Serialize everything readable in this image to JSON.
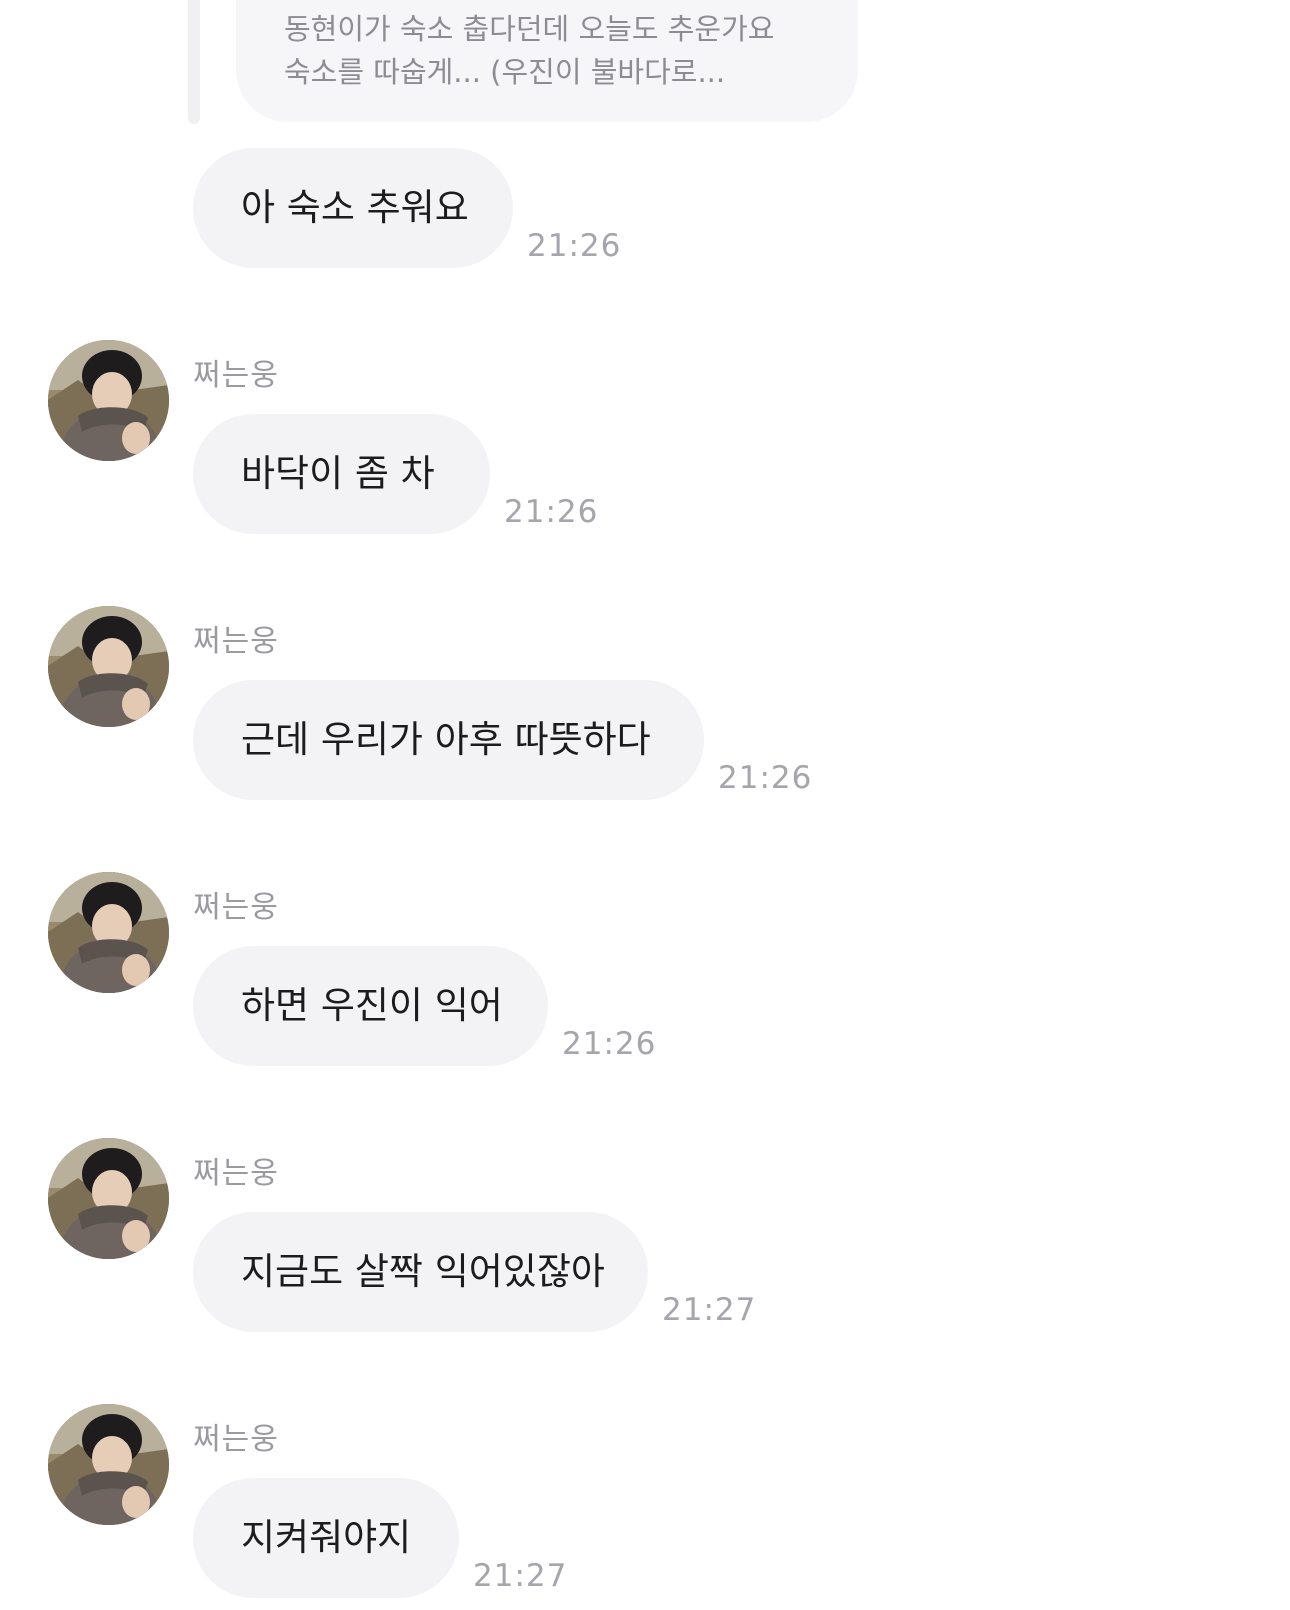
{
  "reply": {
    "lines": [
      "동현이가 숙소 춥다던데 오늘도 추운가요",
      "숙소를 따숩게... (우진이 불바다로..."
    ]
  },
  "messages": [
    {
      "text": "아 숙소 추워요",
      "time": "21:26"
    },
    {
      "sender": "쩌는웅",
      "text": "바닥이 좀 차",
      "time": "21:26"
    },
    {
      "sender": "쩌는웅",
      "text": "근데 우리가 아후 따뜻하다",
      "time": "21:26"
    },
    {
      "sender": "쩌는웅",
      "text": "하면 우진이 익어",
      "time": "21:26"
    },
    {
      "sender": "쩌는웅",
      "text": "지금도 살짝 익어있잖아",
      "time": "21:27"
    },
    {
      "sender": "쩌는웅",
      "text": "지켜줘야지",
      "time": "21:27"
    }
  ],
  "colors": {
    "bubble": "#f3f3f5",
    "text": "#1c1c1e",
    "timestamp": "#a5a5ab",
    "sender": "#9a9aa0"
  }
}
